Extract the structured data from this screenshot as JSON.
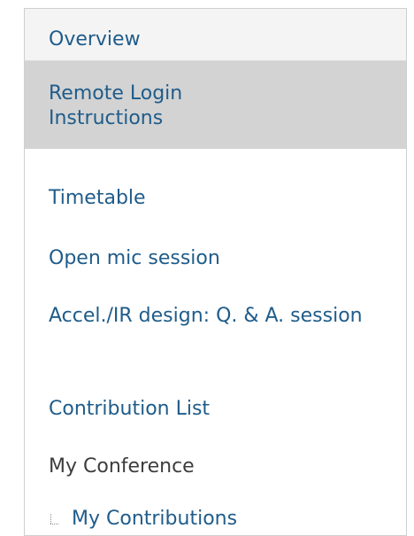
{
  "menu": {
    "items": [
      {
        "label": "Overview"
      },
      {
        "label": "Remote Login Instructions"
      },
      {
        "label": "Timetable"
      },
      {
        "label": "Open mic session"
      },
      {
        "label": "Accel./IR design: Q. & A. session"
      },
      {
        "label": "Contribution List"
      },
      {
        "label": "My Conference"
      },
      {
        "label": "My Contributions"
      }
    ]
  },
  "colors": {
    "link": "#1f5c8a",
    "static_text": "#3d3d3d",
    "selected_bg": "#d3d3d3",
    "first_item_bg": "#f4f4f4",
    "border": "#cfcfcf"
  },
  "icons": {
    "tree": "tree-branch-icon"
  }
}
